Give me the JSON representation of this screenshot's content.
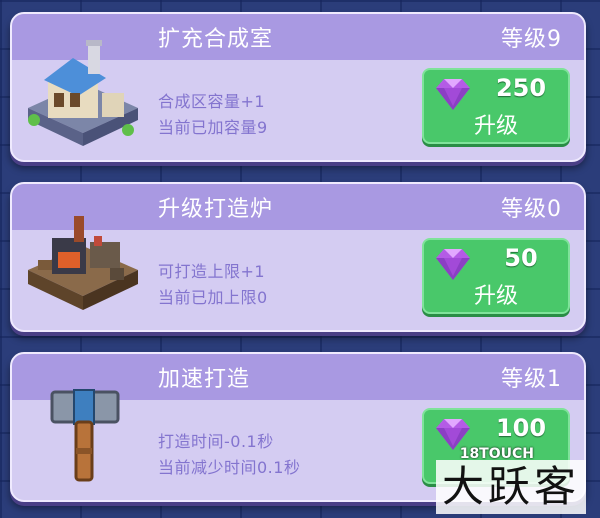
{
  "cards": [
    {
      "title": "扩充合成室",
      "level": "等级9",
      "line1": "合成区容量+1",
      "line2": "当前已加容量9",
      "cost": "250",
      "button_label": "升级",
      "icon": "synthesis-building-icon"
    },
    {
      "title": "升级打造炉",
      "level": "等级0",
      "line1": "可打造上限+1",
      "line2": "当前已加上限0",
      "cost": "50",
      "button_label": "升级",
      "icon": "forge-furnace-icon"
    },
    {
      "title": "加速打造",
      "level": "等级1",
      "line1": "打造时间-0.1秒",
      "line2": "当前减少时间0.1秒",
      "cost": "100",
      "button_label": "",
      "icon": "hammer-icon"
    }
  ],
  "currency_icon": "purple-gem-icon",
  "watermark": {
    "logo": "18TOUCH",
    "text": "大跃客"
  },
  "colors": {
    "background": "#2b3d7a",
    "card": "#d4ccf2",
    "header": "#a999e2",
    "desc_text": "#8374cf",
    "button": "#49c86a"
  }
}
